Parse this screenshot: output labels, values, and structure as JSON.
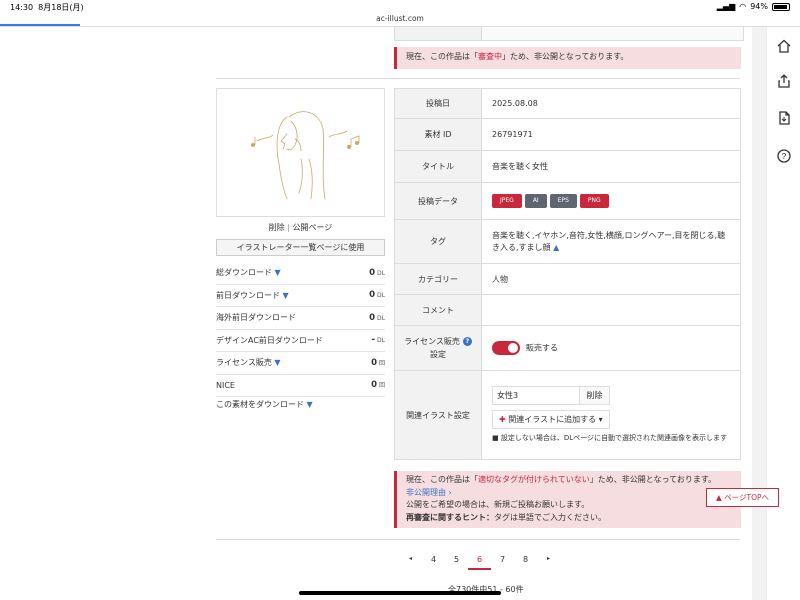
{
  "status": {
    "time": "14:30",
    "date": "8月18日(月)",
    "battery": "94%"
  },
  "browser": {
    "url": "ac-illust.com"
  },
  "alerts": {
    "top": {
      "pre": "現在、この作品は「",
      "highlight": "審査中",
      "post": "」ため、非公開となっております。"
    },
    "bottom": {
      "line1_pre": "現在、この作品は「",
      "line1_highlight": "適切なタグが付けられていない",
      "line1_post": "」ため、非公開となっております。",
      "link": "非公開理由 ›",
      "line3": "公開をご希望の場合は、新規ご投稿お願いします。",
      "hint_label": "再審査に関するヒント：",
      "hint_text": "タグは単語でご入力ください。"
    }
  },
  "left": {
    "delete": "削除",
    "separator": "|",
    "public_page": "公開ページ",
    "use_button": "イラストレーター一覧ページに使用",
    "stats": [
      {
        "label": "総ダウンロード",
        "arrow": "▼",
        "value": "0",
        "unit": "DL"
      },
      {
        "label": "前日ダウンロード",
        "arrow": "▼",
        "value": "0",
        "unit": "DL"
      },
      {
        "label": "海外前日ダウンロード",
        "arrow": "",
        "value": "0",
        "unit": "DL"
      },
      {
        "label": "デザインAC前日ダウンロード",
        "arrow": "",
        "value": "-",
        "unit": "DL"
      },
      {
        "label": "ライセンス販売",
        "arrow": "▼",
        "value": "0",
        "unit": "回"
      },
      {
        "label": "NICE",
        "arrow": "",
        "value": "0",
        "unit": "回"
      }
    ],
    "download_link": "この素材をダウンロード",
    "download_arrow": "▼"
  },
  "info": {
    "date_label": "投稿日",
    "date": "2025.08.08",
    "id_label": "素材 ID",
    "id": "26791971",
    "title_label": "タイトル",
    "title": "音楽を聴く女性",
    "data_label": "投稿データ",
    "formats": [
      {
        "name": "JPEG",
        "color": "#c9273b"
      },
      {
        "name": "AI",
        "color": "#5f6670"
      },
      {
        "name": "EPS",
        "color": "#5f6670"
      },
      {
        "name": "PNG",
        "color": "#c9273b"
      }
    ],
    "tag_label": "タグ",
    "tags": "音楽を聴く,イヤホン,音符,女性,横顔,ロングヘアー,目を閉じる,聴き入る,すまし顔",
    "tag_arrow": "▲",
    "category_label": "カテゴリー",
    "category": "人物",
    "comment_label": "コメント",
    "comment": "",
    "license_label_1": "ライセンス販売",
    "license_label_2": "設定",
    "license_help": "?",
    "license_value": "販売する",
    "related_label": "関連イラスト設定",
    "related_input": "女性3",
    "related_remove": "削除",
    "related_add_plus": "✚",
    "related_add": "関連イラストに追加する ▾",
    "related_note": "■ 設定しない場合は、DLページに自動で選択された関連画像を表示します"
  },
  "pager": {
    "prev": "◂",
    "pages": [
      "4",
      "5",
      "6",
      "7",
      "8"
    ],
    "current": "6",
    "next": "▸"
  },
  "count": "全730件中51 - 60件",
  "pagetop": "▲ ページTOPへ"
}
